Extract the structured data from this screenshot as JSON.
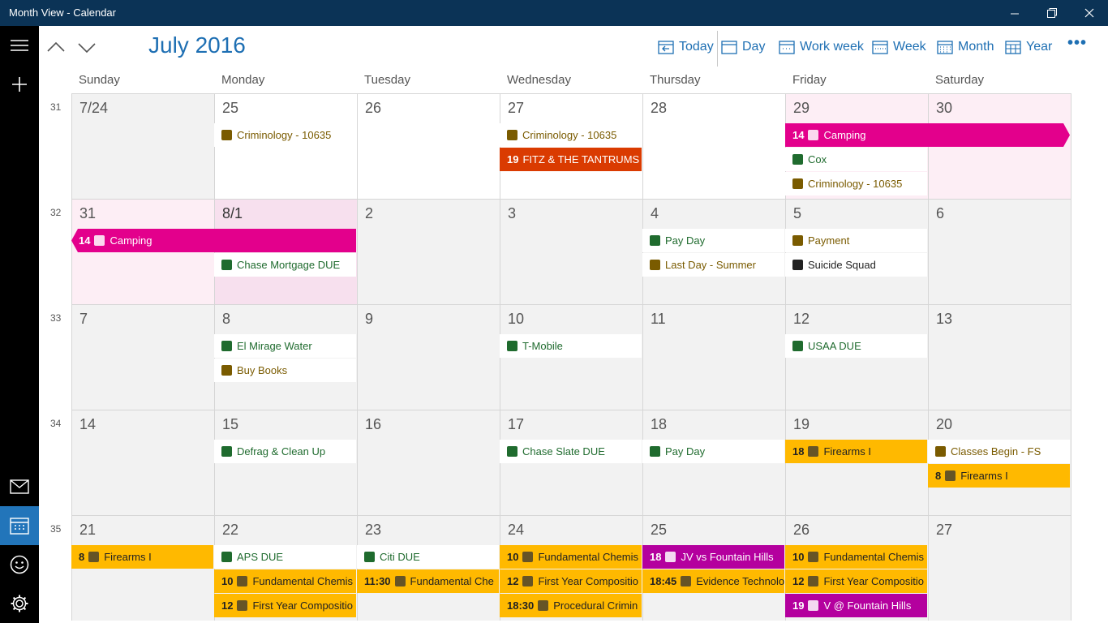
{
  "window": {
    "title": "Month View - Calendar",
    "minimize_icon": "minimize-icon",
    "maximize_icon": "restore-icon",
    "close_icon": "close-icon"
  },
  "rail": {
    "menu_icon": "hamburger-icon",
    "new_icon": "plus-icon",
    "mail_icon": "mail-icon",
    "calendar_icon": "calendar-icon",
    "feedback_icon": "smiley-icon",
    "settings_icon": "gear-icon"
  },
  "header": {
    "month_title": "July 2016",
    "prev_icon": "chevron-up-icon",
    "next_icon": "chevron-down-icon",
    "views": [
      "Today",
      "Day",
      "Work week",
      "Week",
      "Month",
      "Year"
    ],
    "more": "•••"
  },
  "weekdays": [
    "Sunday",
    "Monday",
    "Tuesday",
    "Wednesday",
    "Thursday",
    "Friday",
    "Saturday"
  ],
  "colors": {
    "accent": "#1e6fb3",
    "titlebar": "#0b3356",
    "pink": "#e3008c",
    "gold": "#ffb900",
    "red": "#da3b01",
    "purple": "#b4009e",
    "selected_rail": "#2275ba"
  },
  "weeks": [
    {
      "num": "31",
      "days": [
        "7/24",
        "25",
        "26",
        "27",
        "28",
        "29",
        "30"
      ]
    },
    {
      "num": "32",
      "days": [
        "31",
        "8/1",
        "2",
        "3",
        "4",
        "5",
        "6"
      ]
    },
    {
      "num": "33",
      "days": [
        "7",
        "8",
        "9",
        "10",
        "11",
        "12",
        "13"
      ]
    },
    {
      "num": "34",
      "days": [
        "14",
        "15",
        "16",
        "17",
        "18",
        "19",
        "20"
      ]
    },
    {
      "num": "35",
      "days": [
        "21",
        "22",
        "23",
        "24",
        "25",
        "26",
        "27"
      ]
    }
  ],
  "events": [
    {
      "week": 0,
      "day": 1,
      "slot": 0,
      "time": "",
      "title": "Criminology - 10635",
      "icon": "theater-masks-icon",
      "style": "plain",
      "color": "#7a5b00"
    },
    {
      "week": 0,
      "day": 3,
      "slot": 0,
      "time": "",
      "title": "Criminology - 10635",
      "icon": "theater-masks-icon",
      "style": "plain",
      "color": "#7a5b00"
    },
    {
      "week": 0,
      "day": 3,
      "slot": 1,
      "time": "19",
      "title": "FITZ & THE TANTRUMS -",
      "icon": "",
      "style": "red",
      "color": "#da3b01"
    },
    {
      "week": 0,
      "day": 5,
      "slot": 0,
      "span": 2,
      "time": "14",
      "title": "Camping",
      "icon": "tent-icon",
      "style": "pink",
      "color": "#e3008c"
    },
    {
      "week": 0,
      "day": 5,
      "slot": 1,
      "time": "",
      "title": "Cox",
      "icon": "leaf-icon",
      "style": "plain",
      "color": "#1f6b2e"
    },
    {
      "week": 0,
      "day": 5,
      "slot": 2,
      "time": "",
      "title": "Criminology - 10635",
      "icon": "theater-masks-icon",
      "style": "plain",
      "color": "#7a5b00"
    },
    {
      "week": 1,
      "day": 0,
      "slot": 0,
      "span": 2,
      "time": "14",
      "title": "Camping",
      "icon": "tent-icon",
      "style": "pink",
      "color": "#e3008c"
    },
    {
      "week": 1,
      "day": 1,
      "slot": 1,
      "time": "",
      "title": "Chase Mortgage DUE",
      "icon": "house-icon",
      "style": "plain",
      "color": "#1f6b2e"
    },
    {
      "week": 1,
      "day": 4,
      "slot": 0,
      "time": "",
      "title": "Pay Day",
      "icon": "money-icon",
      "style": "plain",
      "color": "#1f6b2e"
    },
    {
      "week": 1,
      "day": 4,
      "slot": 1,
      "time": "",
      "title": "Last Day - Summer",
      "icon": "sun-icon",
      "style": "plain",
      "color": "#7a5b00"
    },
    {
      "week": 1,
      "day": 5,
      "slot": 0,
      "time": "",
      "title": "Payment",
      "icon": "ticket-icon",
      "style": "plain",
      "color": "#7a5b00"
    },
    {
      "week": 1,
      "day": 5,
      "slot": 1,
      "time": "",
      "title": "Suicide Squad",
      "icon": "bomb-icon",
      "style": "plain",
      "color": "#222"
    },
    {
      "week": 2,
      "day": 1,
      "slot": 0,
      "time": "",
      "title": "El Mirage Water",
      "icon": "water-icon",
      "style": "plain",
      "color": "#1f6b2e"
    },
    {
      "week": 2,
      "day": 1,
      "slot": 1,
      "time": "",
      "title": "Buy Books",
      "icon": "book-icon",
      "style": "plain",
      "color": "#7a5b00"
    },
    {
      "week": 2,
      "day": 3,
      "slot": 0,
      "time": "",
      "title": "T-Mobile",
      "icon": "phone-icon",
      "style": "plain",
      "color": "#1f6b2e"
    },
    {
      "week": 2,
      "day": 5,
      "slot": 0,
      "time": "",
      "title": "USAA DUE",
      "icon": "car-icon",
      "style": "plain",
      "color": "#1f6b2e"
    },
    {
      "week": 3,
      "day": 1,
      "slot": 0,
      "time": "",
      "title": "Defrag & Clean Up",
      "icon": "virus-icon",
      "style": "plain",
      "color": "#1f6b2e"
    },
    {
      "week": 3,
      "day": 3,
      "slot": 0,
      "time": "",
      "title": "Chase Slate DUE",
      "icon": "card-icon",
      "style": "plain",
      "color": "#1f6b2e"
    },
    {
      "week": 3,
      "day": 4,
      "slot": 0,
      "time": "",
      "title": "Pay Day",
      "icon": "money-icon",
      "style": "plain",
      "color": "#1f6b2e"
    },
    {
      "week": 3,
      "day": 5,
      "slot": 0,
      "time": "18",
      "title": "Firearms I",
      "icon": "gun-icon",
      "style": "gold",
      "color": "#ffb900"
    },
    {
      "week": 3,
      "day": 6,
      "slot": 0,
      "time": "",
      "title": "Classes Begin - FS",
      "icon": "pencil-icon",
      "style": "plain",
      "color": "#7a5b00"
    },
    {
      "week": 3,
      "day": 6,
      "slot": 1,
      "time": "8",
      "title": "Firearms I",
      "icon": "gun-icon",
      "style": "gold",
      "color": "#ffb900"
    },
    {
      "week": 4,
      "day": 0,
      "slot": 0,
      "time": "8",
      "title": "Firearms I",
      "icon": "gun-icon",
      "style": "gold",
      "color": "#ffb900"
    },
    {
      "week": 4,
      "day": 1,
      "slot": 0,
      "time": "",
      "title": "APS DUE",
      "icon": "lightbulb-icon",
      "style": "plain",
      "color": "#1f6b2e"
    },
    {
      "week": 4,
      "day": 1,
      "slot": 1,
      "time": "10",
      "title": "Fundamental Chemis",
      "icon": "flask-icon",
      "style": "gold",
      "color": "#ffb900"
    },
    {
      "week": 4,
      "day": 1,
      "slot": 2,
      "time": "12",
      "title": "First Year Compositio",
      "icon": "book-icon",
      "style": "gold",
      "color": "#ffb900"
    },
    {
      "week": 4,
      "day": 2,
      "slot": 0,
      "time": "",
      "title": "Citi DUE",
      "icon": "card-icon",
      "style": "plain",
      "color": "#1f6b2e"
    },
    {
      "week": 4,
      "day": 2,
      "slot": 1,
      "time": "11:30",
      "title": "Fundamental Che",
      "icon": "flask-icon",
      "style": "gold",
      "color": "#ffb900"
    },
    {
      "week": 4,
      "day": 3,
      "slot": 0,
      "time": "10",
      "title": "Fundamental Chemis",
      "icon": "flask-icon",
      "style": "gold",
      "color": "#ffb900"
    },
    {
      "week": 4,
      "day": 3,
      "slot": 1,
      "time": "12",
      "title": "First Year Compositio",
      "icon": "book-icon",
      "style": "gold",
      "color": "#ffb900"
    },
    {
      "week": 4,
      "day": 3,
      "slot": 2,
      "time": "18:30",
      "title": "Procedural Crimin",
      "icon": "gavel-icon",
      "style": "gold",
      "color": "#ffb900"
    },
    {
      "week": 4,
      "day": 4,
      "slot": 0,
      "time": "18",
      "title": "JV vs Fountain Hills",
      "icon": "football-icon",
      "style": "purple",
      "color": "#b4009e"
    },
    {
      "week": 4,
      "day": 4,
      "slot": 1,
      "time": "18:45",
      "title": "Evidence Technolo",
      "icon": "flask-icon",
      "style": "gold",
      "color": "#ffb900"
    },
    {
      "week": 4,
      "day": 5,
      "slot": 0,
      "time": "10",
      "title": "Fundamental Chemis",
      "icon": "flask-icon",
      "style": "gold",
      "color": "#ffb900"
    },
    {
      "week": 4,
      "day": 5,
      "slot": 1,
      "time": "12",
      "title": "First Year Compositio",
      "icon": "book-icon",
      "style": "gold",
      "color": "#ffb900"
    },
    {
      "week": 4,
      "day": 5,
      "slot": 2,
      "time": "19",
      "title": "V @ Fountain Hills",
      "icon": "football-icon",
      "style": "purple",
      "color": "#b4009e"
    }
  ]
}
